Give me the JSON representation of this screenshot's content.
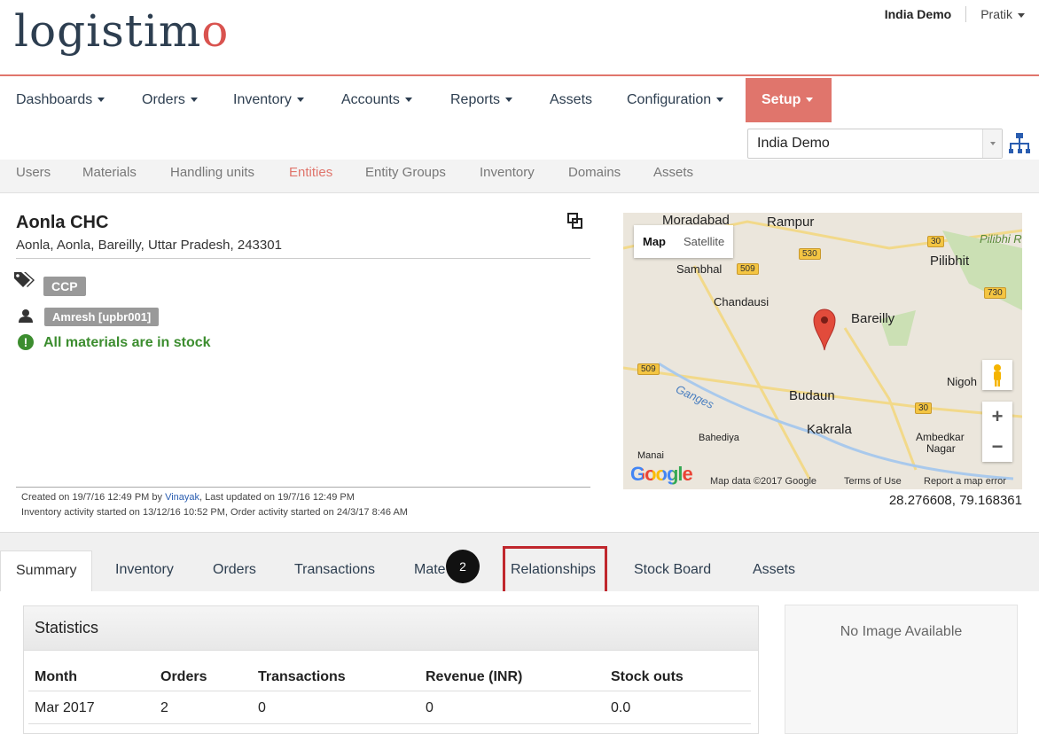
{
  "logo": {
    "text_a": "logistim",
    "text_b": "o"
  },
  "user": {
    "domain": "India Demo",
    "name": "Pratik"
  },
  "nav": [
    {
      "label": "Dashboards",
      "caret": true
    },
    {
      "label": "Orders",
      "caret": true
    },
    {
      "label": "Inventory",
      "caret": true
    },
    {
      "label": "Accounts",
      "caret": true
    },
    {
      "label": "Reports",
      "caret": true
    },
    {
      "label": "Assets",
      "caret": false
    },
    {
      "label": "Configuration",
      "caret": true
    },
    {
      "label": "Setup",
      "caret": true,
      "active": true
    }
  ],
  "domain_select": {
    "value": "India Demo"
  },
  "subnav": [
    "Users",
    "Materials",
    "Handling units",
    "Entities",
    "Entity Groups",
    "Inventory",
    "Domains",
    "Assets"
  ],
  "entity": {
    "name": "Aonla CHC",
    "address": "Aonla, Aonla, Bareilly, Uttar Pradesh, 243301",
    "tag": "CCP",
    "user": "Amresh [upbr001]",
    "stock_status": "All materials are in stock",
    "created": {
      "prefix": "Created on 19/7/16 12:49 PM by ",
      "by": "Vinayak",
      "suffix": ", Last updated on 19/7/16 12:49 PM"
    },
    "activity": "Inventory activity started on 13/12/16 10:52 PM, Order activity started on 24/3/17 8:46 AM"
  },
  "map": {
    "tabs": [
      "Map",
      "Satellite"
    ],
    "places": {
      "moradabad": "Moradabad",
      "rampur": "Rampur",
      "pilibhit": "Pilibhit",
      "pilibhit_res": "Pilibhi Rese",
      "sambhal": "Sambhal",
      "chandausi": "Chandausi",
      "bareilly": "Bareilly",
      "ganges": "Ganges",
      "budaun": "Budaun",
      "nigoh": "Nigoh",
      "kakrala": "Kakrala",
      "bahediya": "Bahediya",
      "manai": "Manai",
      "ambedkar": "Ambedkar",
      "nagar": "Nagar"
    },
    "roads": [
      "30",
      "530",
      "509",
      "730",
      "509",
      "30",
      "730"
    ],
    "google": "Google",
    "map_data": "Map data ©2017 Google",
    "terms": "Terms of Use",
    "report": "Report a map error",
    "coordinates": "28.276608, 79.168361"
  },
  "tabs": [
    "Summary",
    "Inventory",
    "Orders",
    "Transactions",
    "Mate",
    "Relationships",
    "Stock Board",
    "Assets"
  ],
  "step_marker": "2",
  "statistics": {
    "title": "Statistics",
    "columns": [
      "Month",
      "Orders",
      "Transactions",
      "Revenue (INR)",
      "Stock outs"
    ],
    "rows": [
      [
        "Mar 2017",
        "2",
        "0",
        "0",
        "0.0"
      ]
    ]
  },
  "no_image": "No Image Available",
  "colors": {
    "accent": "#e0756c",
    "success": "#3c8d2f",
    "highlight": "#c0272d"
  }
}
